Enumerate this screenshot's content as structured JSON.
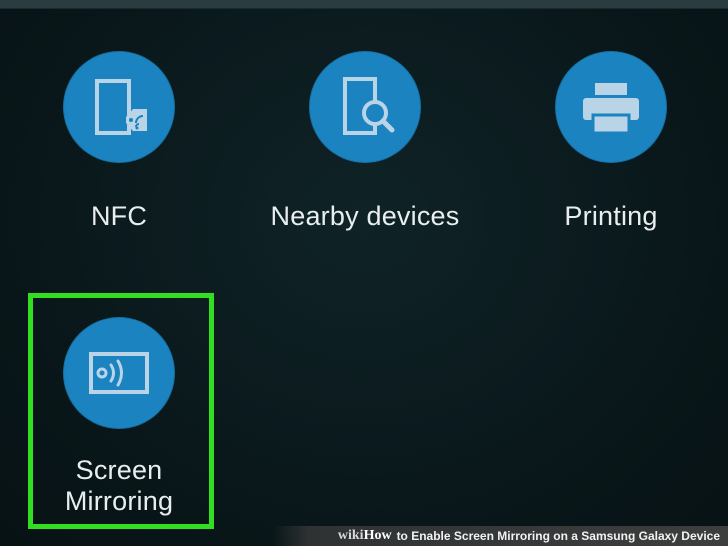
{
  "tiles": {
    "nfc": {
      "label": "NFC",
      "icon": "nfc-icon"
    },
    "nearby": {
      "label": "Nearby devices",
      "icon": "nearby-devices-icon"
    },
    "printing": {
      "label": "Printing",
      "icon": "printer-icon"
    },
    "mirroring": {
      "label_line1": "Screen",
      "label_line2": "Mirroring",
      "icon": "screen-mirroring-icon"
    }
  },
  "highlight": {
    "target": "Screen Mirroring",
    "color": "#33dd22"
  },
  "colors": {
    "background": "#0a1a1e",
    "icon_circle": "#1a83c0",
    "icon_glyph": "#b8d4e6",
    "label_text": "#e8eef0"
  },
  "caption": {
    "wiki": "wiki",
    "how": "How",
    "title": "to Enable Screen Mirroring on a Samsung Galaxy Device"
  }
}
